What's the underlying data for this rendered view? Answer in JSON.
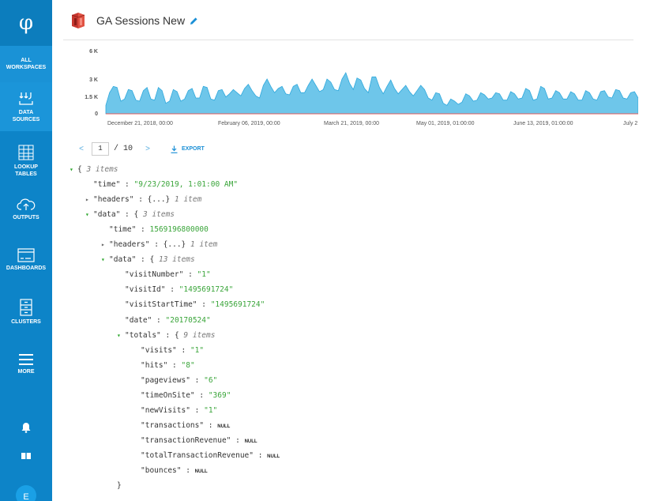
{
  "app": {
    "logo": "φ",
    "sidebar": {
      "workspaces": "ALL\nWORKSPACES",
      "items": [
        {
          "id": "data_sources",
          "label": "DATA\nSOURCES",
          "icon": "data-sources-icon",
          "active": true
        },
        {
          "id": "lookup_tables",
          "label": "LOOKUP\nTABLES",
          "icon": "table-icon"
        },
        {
          "id": "outputs",
          "label": "OUTPUTS",
          "icon": "cloud-upload-icon"
        },
        {
          "id": "dashboards",
          "label": "DASHBOARDS",
          "icon": "dashboard-icon"
        },
        {
          "id": "clusters",
          "label": "CLUSTERS",
          "icon": "cluster-icon"
        },
        {
          "id": "more",
          "label": "MORE",
          "icon": "hamburger-icon"
        }
      ],
      "avatar_initial": "E"
    }
  },
  "header": {
    "title": "GA Sessions New",
    "source_icon": "aws-s3-icon",
    "edit_icon": "pencil-icon"
  },
  "chart_data": {
    "type": "area",
    "title": "",
    "y_ticks": [
      "6 K",
      "3 K",
      "1.5 K",
      "0"
    ],
    "ylim": [
      0,
      6000
    ],
    "x_ticks": [
      "December 21, 2018, 00:00",
      "February 06, 2019, 00:00",
      "March 21, 2019, 00:00",
      "May 01, 2019, 01:00:00",
      "June 13, 2019, 01:00:00",
      "July 2"
    ],
    "values": [
      800,
      2000,
      2600,
      2500,
      1200,
      1400,
      2300,
      2200,
      1300,
      1200,
      2200,
      2500,
      1400,
      1300,
      2500,
      2200,
      1000,
      1200,
      2300,
      2100,
      1200,
      1400,
      2200,
      2400,
      1500,
      1500,
      2600,
      2500,
      1400,
      1300,
      2200,
      2300,
      1600,
      1900,
      2300,
      2000,
      1700,
      2400,
      2800,
      2200,
      1700,
      1500,
      2700,
      3300,
      2600,
      2000,
      2400,
      2600,
      1900,
      1800,
      2600,
      2800,
      2000,
      2000,
      2700,
      3300,
      2700,
      2100,
      2300,
      3300,
      3000,
      2300,
      2200,
      3300,
      3900,
      2900,
      2300,
      3400,
      3200,
      2400,
      2000,
      3500,
      3500,
      2500,
      1900,
      2600,
      3200,
      2400,
      1900,
      2300,
      2700,
      2100,
      1700,
      2200,
      2700,
      2300,
      1500,
      1300,
      2000,
      1900,
      1000,
      800,
      1400,
      1200,
      900,
      1100,
      1900,
      1700,
      1200,
      1300,
      2000,
      1800,
      1400,
      1500,
      2000,
      1900,
      1300,
      1300,
      2100,
      1900,
      1400,
      1500,
      2400,
      2200,
      1300,
      1400,
      2600,
      2400,
      1400,
      1500,
      2200,
      2000,
      1400,
      1400,
      2100,
      1900,
      1300,
      1300,
      2200,
      2000,
      1400,
      1300,
      2100,
      2200,
      1600,
      1500,
      2300,
      2200,
      1500,
      1400,
      2000,
      2100,
      1500
    ]
  },
  "pager": {
    "prev": "<",
    "current": "1",
    "total": "/ 10",
    "next": ">",
    "export_label": "EXPORT"
  },
  "json_tree": [
    {
      "indent": 0,
      "toggle": "open",
      "key": "",
      "brace": "{",
      "meta": "3 items"
    },
    {
      "indent": 1,
      "key": "\"time\"",
      "value": "\"9/23/2019, 1:01:00 AM\"",
      "vtype": "s"
    },
    {
      "indent": 1,
      "toggle": "closed",
      "key": "\"headers\"",
      "brace": "{...}",
      "meta": "1 item"
    },
    {
      "indent": 1,
      "toggle": "open",
      "key": "\"data\"",
      "brace": "{",
      "meta": "3 items"
    },
    {
      "indent": 2,
      "key": "\"time\"",
      "value": "1569196800000",
      "vtype": "n"
    },
    {
      "indent": 2,
      "toggle": "closed",
      "key": "\"headers\"",
      "brace": "{...}",
      "meta": "1 item"
    },
    {
      "indent": 2,
      "toggle": "open",
      "key": "\"data\"",
      "brace": "{",
      "meta": "13 items"
    },
    {
      "indent": 3,
      "key": "\"visitNumber\"",
      "value": "\"1\"",
      "vtype": "s"
    },
    {
      "indent": 3,
      "key": "\"visitId\"",
      "value": "\"1495691724\"",
      "vtype": "s"
    },
    {
      "indent": 3,
      "key": "\"visitStartTime\"",
      "value": "\"1495691724\"",
      "vtype": "s"
    },
    {
      "indent": 3,
      "key": "\"date\"",
      "value": "\"20170524\"",
      "vtype": "s"
    },
    {
      "indent": 3,
      "toggle": "open",
      "key": "\"totals\"",
      "brace": "{",
      "meta": "9 items"
    },
    {
      "indent": 4,
      "key": "\"visits\"",
      "value": "\"1\"",
      "vtype": "s"
    },
    {
      "indent": 4,
      "key": "\"hits\"",
      "value": "\"8\"",
      "vtype": "s"
    },
    {
      "indent": 4,
      "key": "\"pageviews\"",
      "value": "\"6\"",
      "vtype": "s"
    },
    {
      "indent": 4,
      "key": "\"timeOnSite\"",
      "value": "\"369\"",
      "vtype": "s"
    },
    {
      "indent": 4,
      "key": "\"newVisits\"",
      "value": "\"1\"",
      "vtype": "s"
    },
    {
      "indent": 4,
      "key": "\"transactions\"",
      "value": "NULL",
      "vtype": "nul"
    },
    {
      "indent": 4,
      "key": "\"transactionRevenue\"",
      "value": "NULL",
      "vtype": "nul"
    },
    {
      "indent": 4,
      "key": "\"totalTransactionRevenue\"",
      "value": "NULL",
      "vtype": "nul"
    },
    {
      "indent": 4,
      "key": "\"bounces\"",
      "value": "NULL",
      "vtype": "nul"
    },
    {
      "indent": 3,
      "close": "}"
    }
  ],
  "colors": {
    "sidebar": "#0d84c8",
    "area_fill": "#6ec6ea",
    "area_stroke": "#2fa8dc",
    "string_value": "#3aa53a",
    "accent": "#1a8fd6"
  }
}
